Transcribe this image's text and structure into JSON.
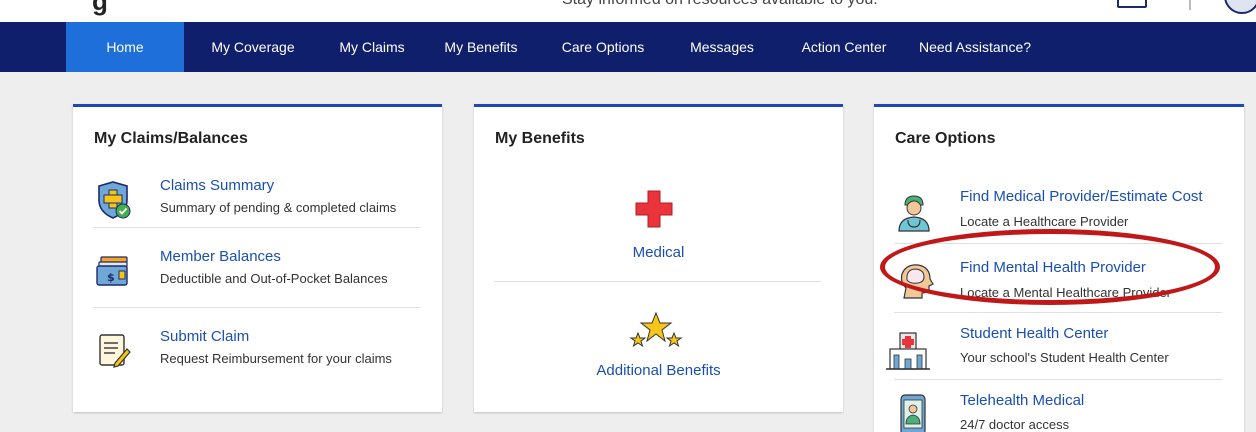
{
  "header": {
    "brand": "g",
    "tagline": "Stay informed on resources available to you."
  },
  "nav": {
    "items": [
      {
        "label": "Home"
      },
      {
        "label": "My Coverage"
      },
      {
        "label": "My Claims"
      },
      {
        "label": "My Benefits"
      },
      {
        "label": "Care Options"
      },
      {
        "label": "Messages"
      },
      {
        "label": "Action Center"
      },
      {
        "label": "Need Assistance?"
      }
    ]
  },
  "claims_card": {
    "title": "My Claims/Balances",
    "items": [
      {
        "link": "Claims Summary",
        "desc": "Summary of pending & completed claims",
        "icon": "shield-check-icon"
      },
      {
        "link": "Member Balances",
        "desc": "Deductible and Out-of-Pocket Balances",
        "icon": "wallet-dollar-icon"
      },
      {
        "link": "Submit Claim",
        "desc": "Request Reimbursement for your claims",
        "icon": "document-pencil-icon"
      }
    ]
  },
  "benefits_card": {
    "title": "My Benefits",
    "items": [
      {
        "label": "Medical",
        "icon": "medical-cross-icon"
      },
      {
        "label": "Additional Benefits",
        "icon": "stars-icon"
      }
    ]
  },
  "care_card": {
    "title": "Care Options",
    "items": [
      {
        "link": "Find Medical Provider/Estimate Cost",
        "desc": "Locate a Healthcare Provider",
        "icon": "doctor-icon"
      },
      {
        "link": "Find Mental Health Provider",
        "desc": "Locate a Mental Healthcare Provider",
        "icon": "brain-head-icon"
      },
      {
        "link": "Student Health Center",
        "desc": "Your school's Student Health Center",
        "icon": "hospital-icon"
      },
      {
        "link": "Telehealth Medical",
        "desc": "24/7 doctor access",
        "icon": "phone-doctor-icon"
      }
    ]
  },
  "colors": {
    "nav_bg": "#0f1f6b",
    "nav_active": "#1e6fd9",
    "link": "#1a4fb0",
    "accent": "#1f47b0",
    "highlight": "#c01818"
  }
}
